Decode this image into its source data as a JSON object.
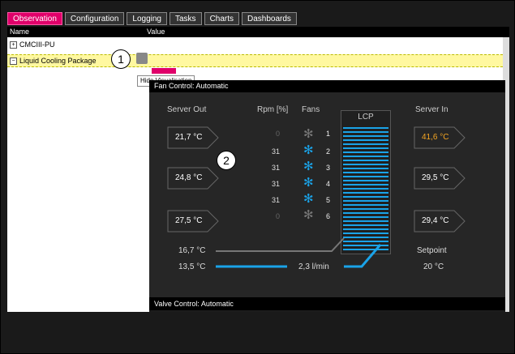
{
  "tabs": [
    "Observation",
    "Configuration",
    "Logging",
    "Tasks",
    "Charts",
    "Dashboards"
  ],
  "table": {
    "col_name": "Name",
    "col_value": "Value"
  },
  "tree": {
    "item1": "CMCIII-PU",
    "item2": "Liquid Cooling Package"
  },
  "callouts": {
    "c1": "1",
    "c2": "2"
  },
  "tooltip": "Hide Visualisation",
  "vis": {
    "fan_control": "Fan Control:  Automatic",
    "valve_control": "Valve Control:  Automatic",
    "server_out_label": "Server Out",
    "rpm_label": "Rpm [%]",
    "fans_label": "Fans",
    "lcp_label": "LCP",
    "server_in_label": "Server In",
    "server_out": [
      "21,7 °C",
      "24,8 °C",
      "27,5 °C"
    ],
    "server_in": [
      "41,6 °C",
      "29,5 °C",
      "29,4 °C"
    ],
    "rpm": [
      "0",
      "31",
      "31",
      "31",
      "31",
      "0"
    ],
    "fan_numbers": [
      "1",
      "2",
      "3",
      "4",
      "5",
      "6"
    ],
    "fan_states": [
      "off",
      "on",
      "on",
      "on",
      "on",
      "off"
    ],
    "temp_return": "16,7 °C",
    "temp_supply": "13,5 °C",
    "flow": "2,3 l/min",
    "setpoint_label": "Setpoint",
    "setpoint": "20 °C"
  },
  "colors": {
    "accent": "#e0006a",
    "fan_on": "#1aa3e8",
    "warning": "#f5a623"
  }
}
